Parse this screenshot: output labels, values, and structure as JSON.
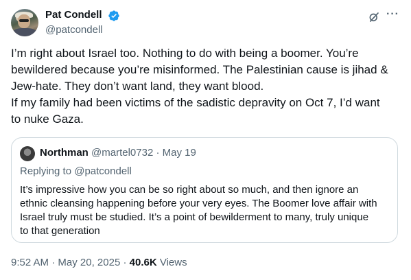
{
  "author": {
    "name": "Pat Condell",
    "handle": "@patcondell",
    "verified": true,
    "verified_color": "#1d9bf0"
  },
  "tweet": {
    "lines": [
      "I’m right about Israel too. Nothing to do with being a boomer. You’re",
      "bewildered because you’re misinformed. The Palestinian cause is jihad &",
      "Jew-hate. They don’t want land, they want blood.",
      "If my family had been victims of the sadistic depravity on Oct 7, I’d want",
      "to nuke Gaza."
    ]
  },
  "quote": {
    "name": "Northman",
    "handle": "@martel0732",
    "separator": "·",
    "date": "May 19",
    "replying_to": "Replying to @patcondell",
    "lines": [
      "It’s impressive how you can be so right about so much, and then ignore an",
      "ethnic cleansing happening before your very eyes.  The Boomer love affair with",
      "Israel truly must be studied.  It’s a point of bewilderment to many, truly unique",
      "to that generation"
    ]
  },
  "meta": {
    "time": "9:52 AM",
    "separator": "·",
    "date": "May 20, 2025",
    "views_count": "40.6K",
    "views_label": "Views"
  },
  "icons": {
    "grok": "grok-icon",
    "more": "more-icon",
    "verified": "verified-badge-icon"
  },
  "colors": {
    "text": "#0f1419",
    "secondary": "#536471",
    "border": "#cfd9de",
    "accent": "#1d9bf0"
  }
}
